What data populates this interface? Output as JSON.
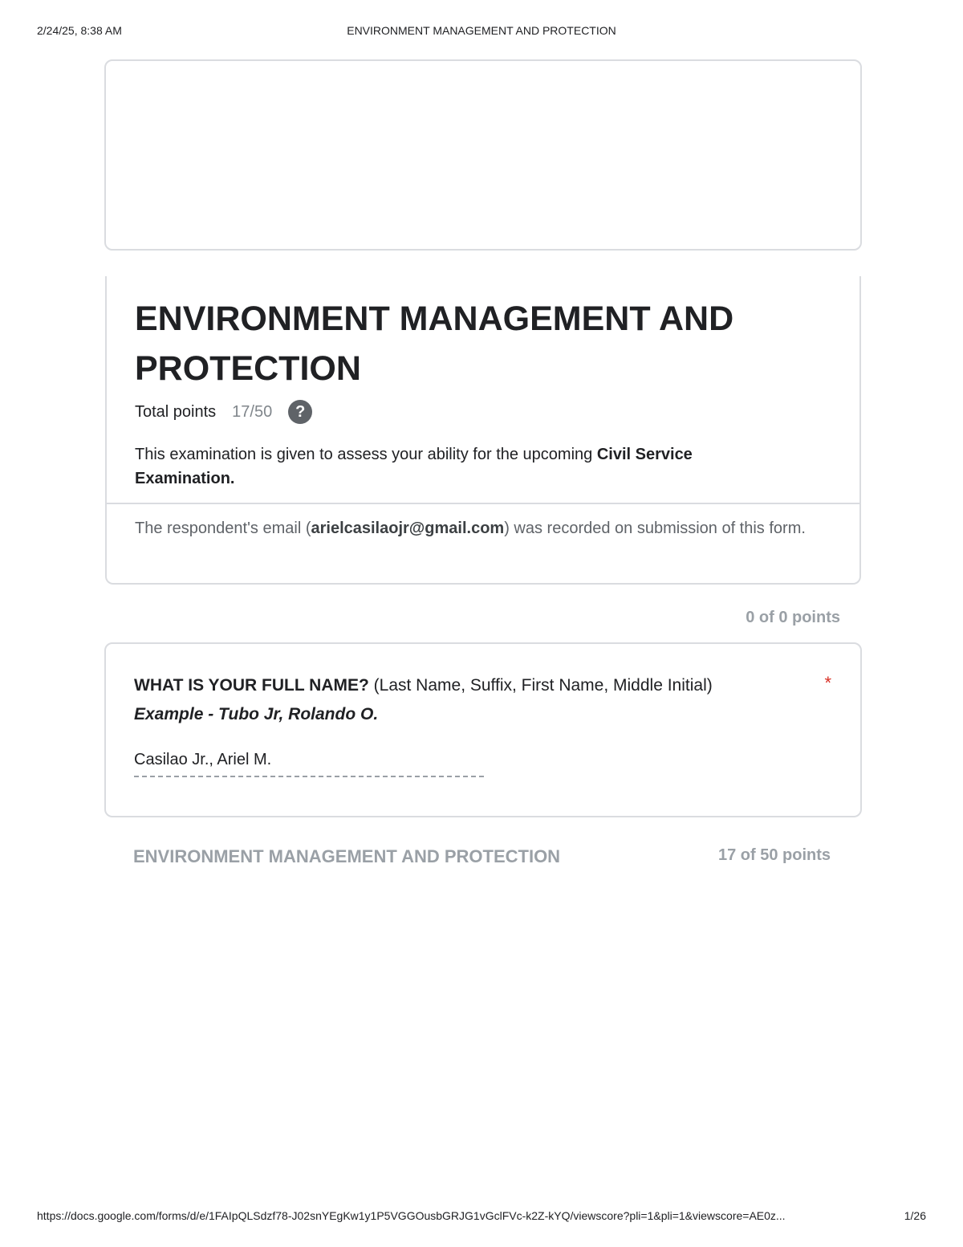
{
  "print_header": {
    "datetime": "2/24/25, 8:38 AM",
    "title": "ENVIRONMENT MANAGEMENT AND PROTECTION"
  },
  "form": {
    "title": "ENVIRONMENT MANAGEMENT AND PROTECTION",
    "total_points_label": "Total points",
    "total_points_value": "17/50",
    "help_icon_glyph": "?",
    "description_prefix": "This examination is given to assess your ability for the upcoming ",
    "description_bold": "Civil Service Examination.",
    "email_prefix": "The respondent's email (",
    "email": "arielcasilaojr@gmail.com",
    "email_suffix": ") was recorded on submission of this form."
  },
  "section_intro": {
    "points": "0 of 0 points"
  },
  "question_name": {
    "label_bold": "WHAT IS YOUR FULL NAME?",
    "label_normal": " (Last Name, Suffix, First Name, Middle Initial) ",
    "label_example": "Example - Tubo Jr, Rolando O.",
    "required_marker": "*",
    "answer": "Casilao Jr., Ariel M."
  },
  "section_main": {
    "title": "ENVIRONMENT MANAGEMENT AND PROTECTION",
    "points": "17 of 50 points"
  },
  "print_footer": {
    "url": "https://docs.google.com/forms/d/e/1FAIpQLSdzf78-J02snYEgKw1y1P5VGGOusbGRJG1vGclFVc-k2Z-kYQ/viewscore?pli=1&pli=1&viewscore=AE0z...",
    "page": "1/26"
  }
}
